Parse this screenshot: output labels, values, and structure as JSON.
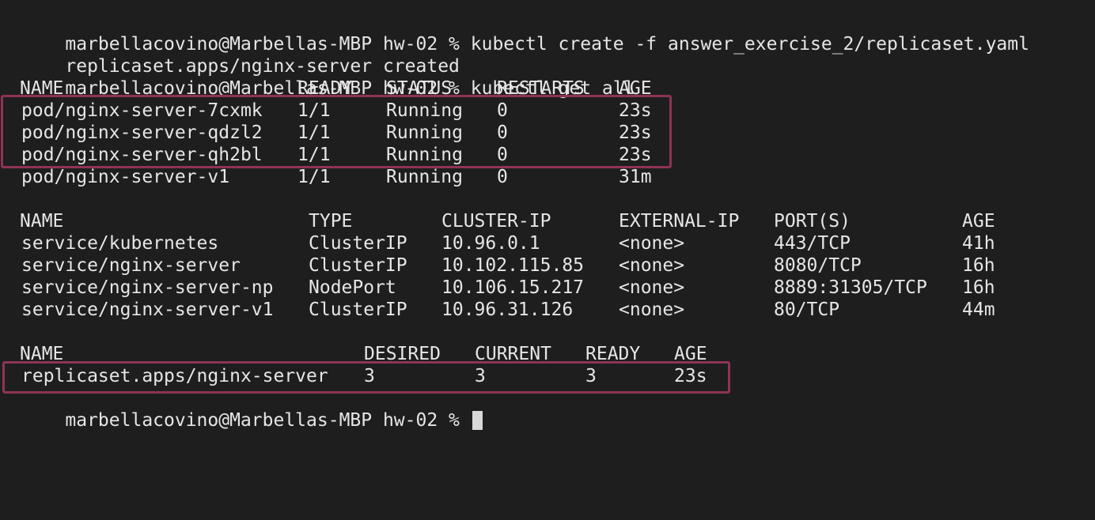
{
  "commands": [
    {
      "prompt": "marbellacovino@Marbellas-MBP hw-02 % ",
      "command": "kubectl create -f answer_exercise_2/replicaset.yaml"
    },
    {
      "output": "replicaset.apps/nginx-server created"
    },
    {
      "prompt": "marbellacovino@Marbellas-MBP hw-02 % ",
      "command": "kubectl get all"
    }
  ],
  "pods": {
    "headers": [
      "NAME",
      "READY",
      "STATUS",
      "RESTARTS",
      "AGE"
    ],
    "rows": [
      [
        "pod/nginx-server-7cxmk",
        "1/1",
        "Running",
        "0",
        "23s"
      ],
      [
        "pod/nginx-server-qdzl2",
        "1/1",
        "Running",
        "0",
        "23s"
      ],
      [
        "pod/nginx-server-qh2bl",
        "1/1",
        "Running",
        "0",
        "23s"
      ],
      [
        "pod/nginx-server-v1",
        "1/1",
        "Running",
        "0",
        "31m"
      ]
    ]
  },
  "services": {
    "headers": [
      "NAME",
      "TYPE",
      "CLUSTER-IP",
      "EXTERNAL-IP",
      "PORT(S)",
      "AGE"
    ],
    "rows": [
      [
        "service/kubernetes",
        "ClusterIP",
        "10.96.0.1",
        "<none>",
        "443/TCP",
        "41h"
      ],
      [
        "service/nginx-server",
        "ClusterIP",
        "10.102.115.85",
        "<none>",
        "8080/TCP",
        "16h"
      ],
      [
        "service/nginx-server-np",
        "NodePort",
        "10.106.15.217",
        "<none>",
        "8889:31305/TCP",
        "16h"
      ],
      [
        "service/nginx-server-v1",
        "ClusterIP",
        "10.96.31.126",
        "<none>",
        "80/TCP",
        "44m"
      ]
    ]
  },
  "replicasets": {
    "headers": [
      "NAME",
      "DESIRED",
      "CURRENT",
      "READY",
      "AGE"
    ],
    "rows": [
      [
        "replicaset.apps/nginx-server",
        "3",
        "3",
        "3",
        "23s"
      ]
    ]
  },
  "final_prompt": "marbellacovino@Marbellas-MBP hw-02 % ",
  "colors": {
    "background": "#1e1e1e",
    "text": "#e6e6e6",
    "highlight_box": "#8e3356"
  }
}
